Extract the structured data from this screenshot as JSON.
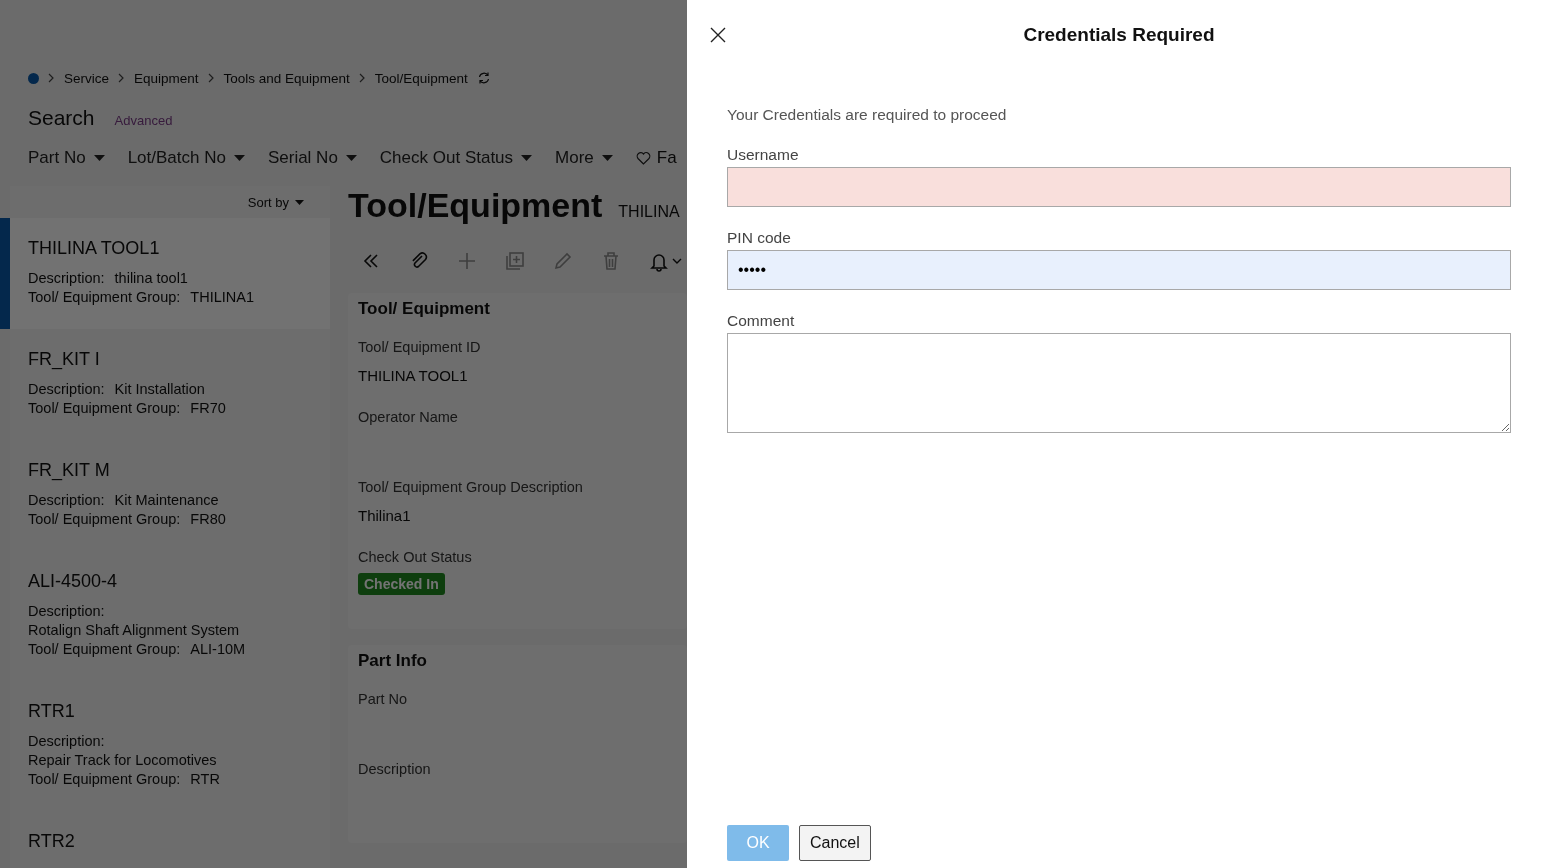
{
  "breadcrumb": {
    "items": [
      "Service",
      "Equipment",
      "Tools and Equipment",
      "Tool/Equipment"
    ]
  },
  "search": {
    "title": "Search",
    "advanced": "Advanced"
  },
  "filters": [
    {
      "label": "Part No",
      "kind": "dropdown"
    },
    {
      "label": "Lot/Batch No",
      "kind": "dropdown"
    },
    {
      "label": "Serial No",
      "kind": "dropdown"
    },
    {
      "label": "Check Out Status",
      "kind": "dropdown"
    },
    {
      "label": "More",
      "kind": "dropdown"
    },
    {
      "label": "Fa",
      "kind": "favorite"
    }
  ],
  "list": {
    "sort_label": "Sort by",
    "items": [
      {
        "title": "THILINA TOOL1",
        "selected": true,
        "description_label": "Description:",
        "description": "thilina tool1",
        "group_label": "Tool/ Equipment Group:",
        "group": "THILINA1"
      },
      {
        "title": "FR_KIT I",
        "selected": false,
        "description_label": "Description:",
        "description": "Kit Installation",
        "group_label": "Tool/ Equipment Group:",
        "group": "FR70"
      },
      {
        "title": "FR_KIT M",
        "selected": false,
        "description_label": "Description:",
        "description": "Kit Maintenance",
        "group_label": "Tool/ Equipment Group:",
        "group": "FR80"
      },
      {
        "title": "ALI-4500-4",
        "selected": false,
        "description_label": "Description:",
        "description": "Rotalign Shaft Alignment System",
        "group_label": "Tool/ Equipment Group:",
        "group": "ALI-10M"
      },
      {
        "title": "RTR1",
        "selected": false,
        "description_label": "Description:",
        "description": "Repair Track for Locomotives",
        "group_label": "Tool/ Equipment Group:",
        "group": "RTR"
      },
      {
        "title": "RTR2",
        "selected": false
      }
    ]
  },
  "detail": {
    "title": "Tool/Equipment",
    "subtitle": "THILINA",
    "toolbar": [
      {
        "kind": "back",
        "disabled": false
      },
      {
        "kind": "attach",
        "disabled": false
      },
      {
        "kind": "add",
        "disabled": true
      },
      {
        "kind": "duplicate",
        "disabled": true
      },
      {
        "kind": "edit",
        "disabled": true
      },
      {
        "kind": "delete",
        "disabled": true
      },
      {
        "kind": "notify",
        "disabled": false
      }
    ],
    "cards": [
      {
        "title": "Tool/ Equipment",
        "fields": [
          {
            "label": "Tool/ Equipment ID",
            "value": "THILINA TOOL1"
          },
          {
            "label": "Operator Name"
          },
          {
            "label": "Tool/ Equipment Group Description",
            "value": "Thilina1"
          },
          {
            "label": "Check Out Status",
            "badge": "Checked In"
          }
        ]
      },
      {
        "title": "Part Info",
        "fields": [
          {
            "label": "Part No"
          },
          {
            "label": "Description"
          }
        ]
      }
    ]
  },
  "dialog": {
    "title": "Credentials Required",
    "message": "Your Credentials are required to proceed",
    "fields": [
      {
        "label": "Username",
        "kind": "text",
        "invalid": true,
        "highlighted": false
      },
      {
        "label": "PIN code",
        "kind": "text",
        "value": "•••••",
        "invalid": false,
        "highlighted": true
      },
      {
        "label": "Comment",
        "kind": "textarea",
        "invalid": false,
        "highlighted": false
      }
    ],
    "buttons": [
      {
        "label": "OK",
        "kind": "primary",
        "disabled": true
      },
      {
        "label": "Cancel",
        "kind": "secondary",
        "disabled": false
      }
    ]
  }
}
